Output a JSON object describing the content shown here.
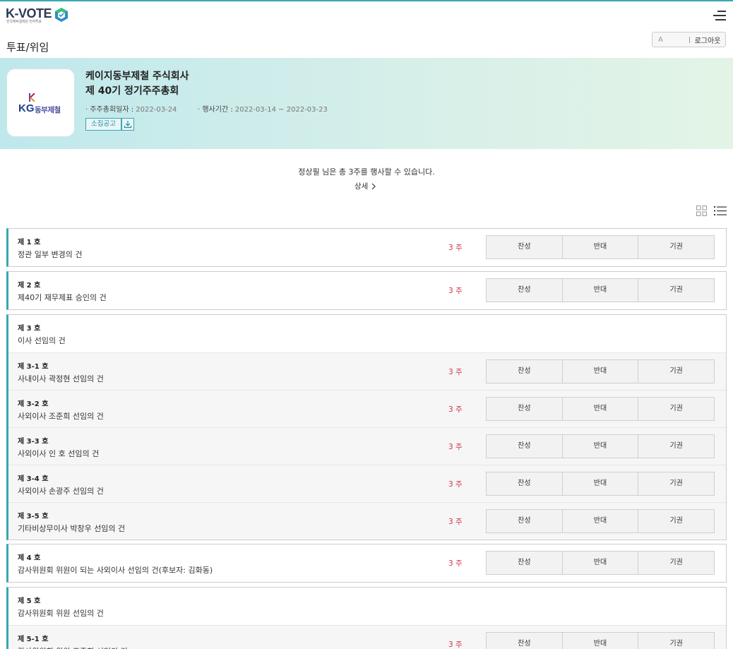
{
  "app": {
    "logo_text": "K-VOTE",
    "logo_sub": "한국예탁결제원 전자투표"
  },
  "header": {
    "page_title": "투표/위임",
    "user_name": "A",
    "logout_label": "로그아웃"
  },
  "meeting": {
    "company": "케이지동부제철 주식회사",
    "title": "제 40기 정기주주총회",
    "date_label": "· 주주총회일자 : ",
    "date_value": "2022-03-24",
    "period_label": "· 행사기간 : ",
    "period_value": "2022-03-14 ~ 2022-03-23",
    "notice_label": "소집공고",
    "logo_kg": "KG",
    "logo_name": "동부제철"
  },
  "summary": {
    "message": "정상필 님은 총 3주를 행사할 수 있습니다.",
    "detail_label": "상세"
  },
  "vote_labels": {
    "for": "찬성",
    "against": "반대",
    "abstain": "기권"
  },
  "agenda": [
    {
      "rows": [
        {
          "no": "제 1 호",
          "title": "정관 일부 변경의 건",
          "shares": "3 주",
          "vote": true
        }
      ]
    },
    {
      "rows": [
        {
          "no": "제 2 호",
          "title": "제40기 재무제표 승인의 건",
          "shares": "3 주",
          "vote": true
        }
      ]
    },
    {
      "rows": [
        {
          "no": "제 3 호",
          "title": "이사 선임의 건",
          "shares": "",
          "vote": false
        },
        {
          "no": "제 3-1 호",
          "title": "사내이사 곽정현 선임의 건",
          "shares": "3 주",
          "vote": true
        },
        {
          "no": "제 3-2 호",
          "title": "사외이사 조준희 선임의 건",
          "shares": "3 주",
          "vote": true
        },
        {
          "no": "제 3-3 호",
          "title": "사외이사 인 호 선임의 건",
          "shares": "3 주",
          "vote": true
        },
        {
          "no": "제 3-4 호",
          "title": "사외이사 손광주 선임의 건",
          "shares": "3 주",
          "vote": true
        },
        {
          "no": "제 3-5 호",
          "title": "기타비상무이사 박창우 선임의 건",
          "shares": "3 주",
          "vote": true
        }
      ]
    },
    {
      "rows": [
        {
          "no": "제 4 호",
          "title": "감사위원회 위원이 되는 사외이사 선임의 건(후보자: 김화동)",
          "shares": "3 주",
          "vote": true
        }
      ]
    },
    {
      "rows": [
        {
          "no": "제 5 호",
          "title": "감사위원회 위원 선임의 건",
          "shares": "",
          "vote": false
        },
        {
          "no": "제 5-1 호",
          "title": "감사위원회 위원 조준희 선임의 건",
          "shares": "3 주",
          "vote": true
        }
      ]
    }
  ],
  "colors": {
    "accent": "#3aa6b4",
    "shares": "#d0344f"
  }
}
